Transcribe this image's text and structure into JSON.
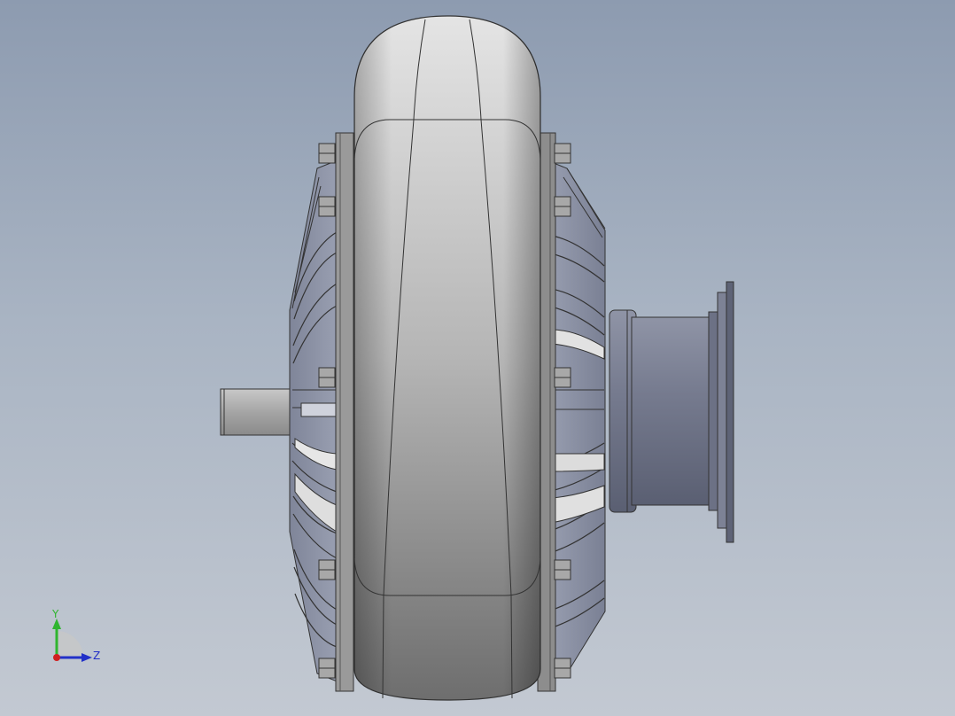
{
  "viewport": {
    "background_top": "#8d9bb0",
    "background_bottom": "#c3c9d2"
  },
  "model": {
    "name": "fluid-coupling-assembly",
    "components": [
      "outer-shell",
      "impeller-fins-left",
      "impeller-fins-right",
      "flange-bolts",
      "input-shaft",
      "output-hub"
    ]
  },
  "triad": {
    "y_label": "Y",
    "z_label": "Z",
    "y_color": "#2fb52f",
    "z_color": "#2230c8",
    "x_color": "#d02020"
  }
}
